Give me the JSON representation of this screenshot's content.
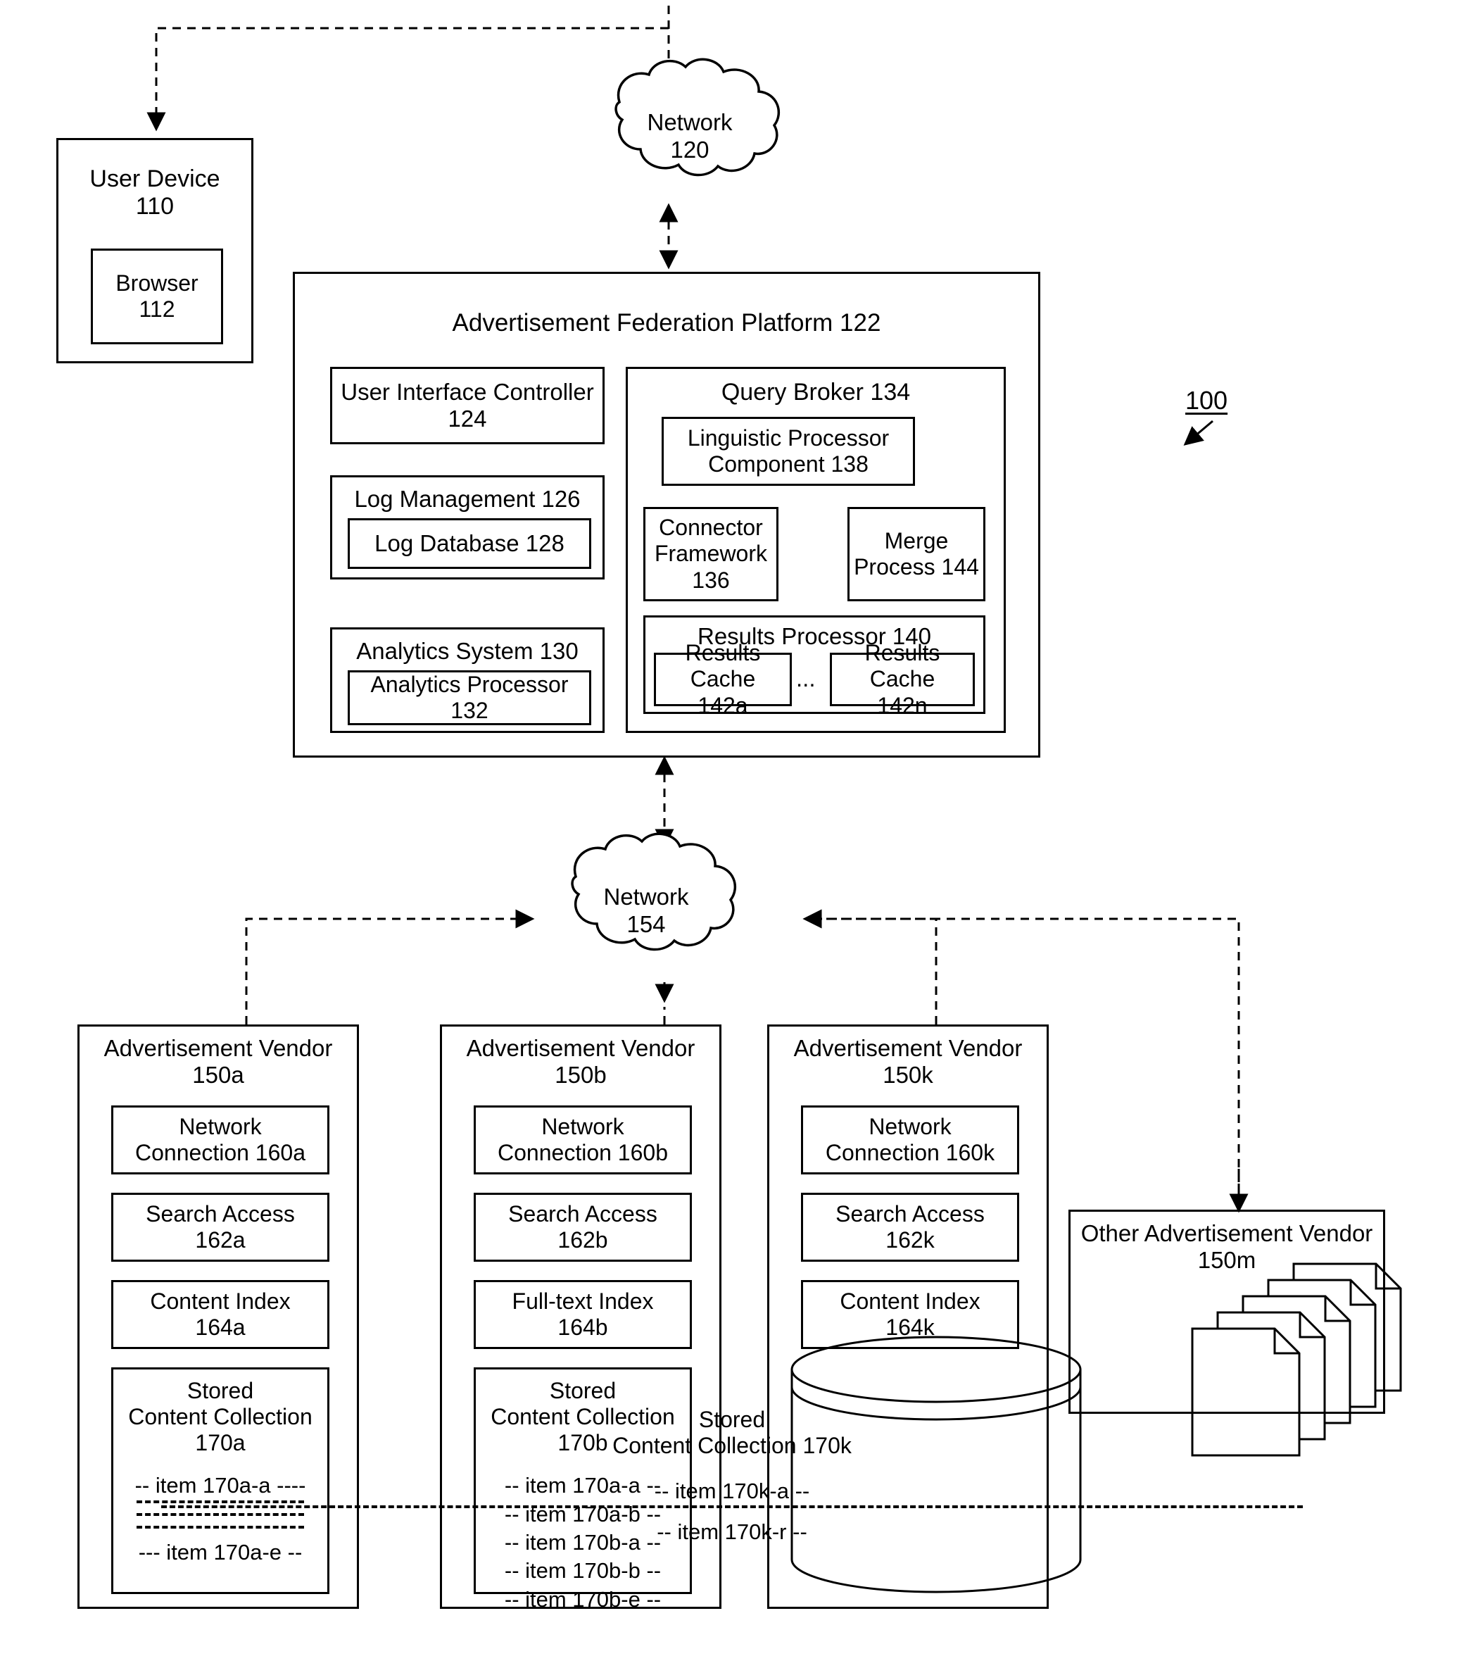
{
  "figure": {
    "reference_numeral": "100"
  },
  "user_device": {
    "title": "User Device\n110",
    "browser": "Browser\n112"
  },
  "network_top": {
    "label": "Network\n120"
  },
  "platform": {
    "title": "Advertisement Federation Platform 122",
    "left_column": {
      "ui_controller": "User Interface Controller\n124",
      "log_management": "Log Management 126",
      "log_database": "Log Database 128",
      "analytics_system": "Analytics System 130",
      "analytics_processor": "Analytics Processor\n132"
    },
    "query_broker": {
      "title": "Query Broker 134",
      "linguistic_processor": "Linguistic Processor\nComponent 138",
      "connector_framework": "Connector\nFramework\n136",
      "merge_process": "Merge\nProcess 144",
      "results_processor": {
        "title": "Results Processor 140",
        "cache_first": "Results Cache\n142a",
        "cache_ellipsis": "...",
        "cache_last": "Results Cache\n142n"
      }
    }
  },
  "network_bottom": {
    "label": "Network\n154"
  },
  "vendors": [
    {
      "title": "Advertisement Vendor\n150a",
      "network_connection": "Network\nConnection 160a",
      "search_access": "Search Access\n162a",
      "index": "Content Index\n164a",
      "collection_title": "Stored\nContent Collection\n170a",
      "collection_items": [
        "-- item 170a-a ----",
        "rule",
        "rule",
        "rule",
        "--- item 170a-e --"
      ]
    },
    {
      "title": "Advertisement Vendor\n150b",
      "network_connection": "Network\nConnection 160b",
      "search_access": "Search Access\n162b",
      "index": "Full-text Index\n164b",
      "collection_title": "Stored\nContent Collection\n170b",
      "collection_items": [
        "-- item 170a-a --",
        "-- item 170a-b --",
        "-- item 170b-a --",
        "-- item 170b-b --",
        "-- item 170b-e --"
      ]
    },
    {
      "title": "Advertisement Vendor\n150k",
      "network_connection": "Network\nConnection 160k",
      "search_access": "Search Access\n162k",
      "index": "Content Index\n164k",
      "collection_title": "Stored\nContent Collection 170k",
      "collection_items": [
        "-- item 170k-a --",
        "rule",
        "-- item 170k-r --"
      ]
    }
  ],
  "other_vendor": {
    "title": "Other Advertisement Vendor\n150m"
  }
}
